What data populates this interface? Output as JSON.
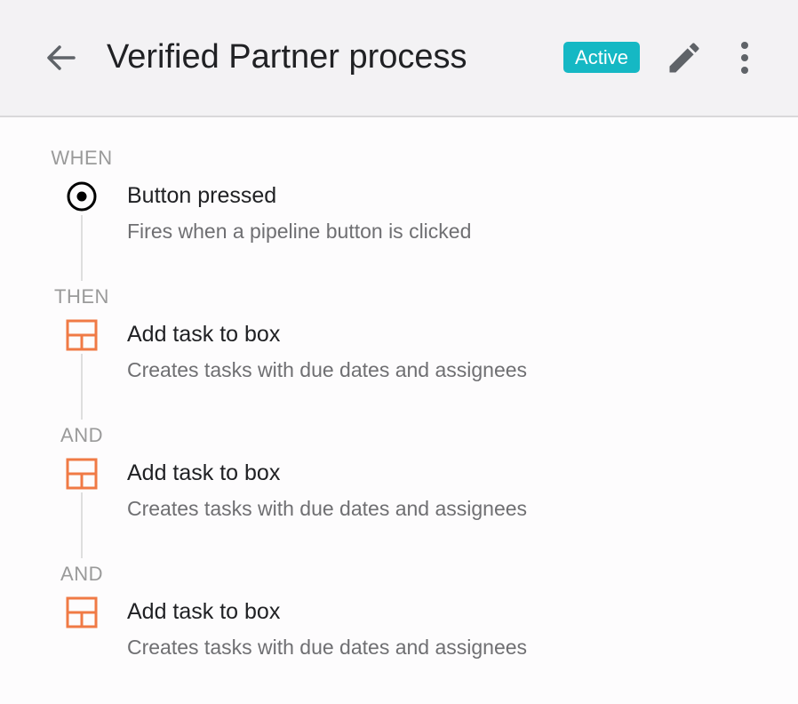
{
  "header": {
    "title": "Verified Partner process",
    "status_badge": "Active",
    "back_icon": "arrow-left-icon",
    "edit_icon": "pencil-icon",
    "more_icon": "more-vertical-icon"
  },
  "colors": {
    "header_bg": "#f3f2f4",
    "badge_bg": "#15b8c4",
    "action_icon": "#f07a45",
    "trigger_icon": "#000000"
  },
  "steps": [
    {
      "label": "WHEN",
      "icon": "radio-target-icon",
      "title": "Button pressed",
      "description": "Fires when a pipeline button is clicked"
    },
    {
      "label": "THEN",
      "icon": "box-layout-icon",
      "title": "Add task to box",
      "description": "Creates tasks with due dates and assignees"
    },
    {
      "label": "AND",
      "icon": "box-layout-icon",
      "title": "Add task to box",
      "description": "Creates tasks with due dates and assignees"
    },
    {
      "label": "AND",
      "icon": "box-layout-icon",
      "title": "Add task to box",
      "description": "Creates tasks with due dates and assignees"
    }
  ]
}
